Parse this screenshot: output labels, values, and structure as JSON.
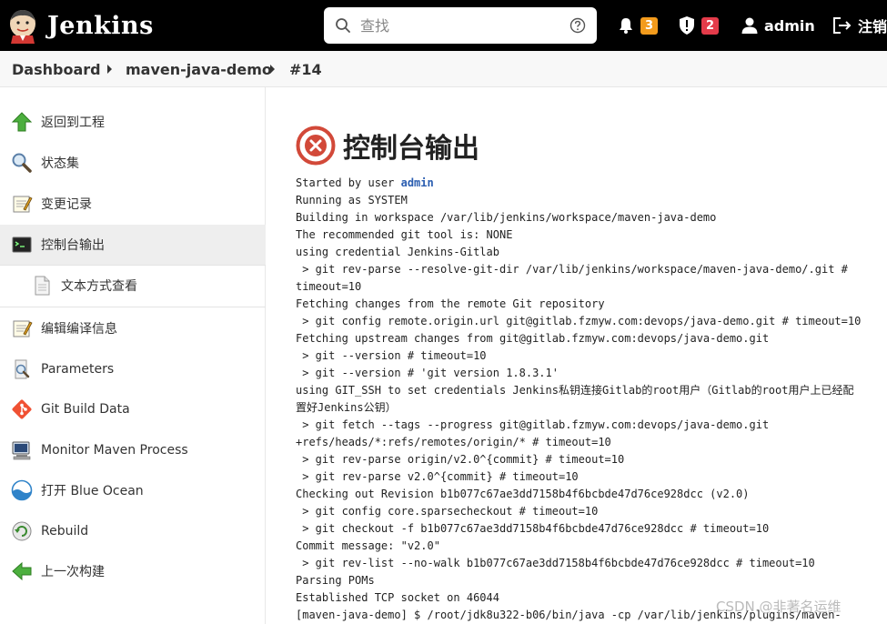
{
  "header": {
    "brand": "Jenkins",
    "search_placeholder": "查找",
    "notifications_count": "3",
    "security_count": "2",
    "user": "admin",
    "logout": "注销"
  },
  "breadcrumb": [
    "Dashboard",
    "maven-java-demo",
    "#14"
  ],
  "sidebar": {
    "items": [
      {
        "label": "返回到工程",
        "icon": "up-arrow-icon"
      },
      {
        "label": "状态集",
        "icon": "magnifier-icon"
      },
      {
        "label": "变更记录",
        "icon": "notepad-icon"
      },
      {
        "label": "控制台输出",
        "icon": "terminal-icon"
      },
      {
        "label": "文本方式查看",
        "icon": "document-icon"
      },
      {
        "label": "编辑编译信息",
        "icon": "notepad-icon"
      },
      {
        "label": "Parameters",
        "icon": "magnifier-doc-icon"
      },
      {
        "label": "Git Build Data",
        "icon": "git-icon"
      },
      {
        "label": "Monitor Maven Process",
        "icon": "computer-icon"
      },
      {
        "label": "打开 Blue Ocean",
        "icon": "blue-ocean-icon"
      },
      {
        "label": "Rebuild",
        "icon": "rebuild-icon"
      },
      {
        "label": "上一次构建",
        "icon": "back-arrow-icon"
      }
    ]
  },
  "main": {
    "title": "控制台输出",
    "status_color": "#d24939",
    "console_prefix": "Started by user ",
    "console_user": "admin",
    "console_lines": [
      "Running as SYSTEM",
      "Building in workspace /var/lib/jenkins/workspace/maven-java-demo",
      "The recommended git tool is: NONE",
      "using credential Jenkins-Gitlab",
      " > git rev-parse --resolve-git-dir /var/lib/jenkins/workspace/maven-java-demo/.git #",
      "timeout=10",
      "Fetching changes from the remote Git repository",
      " > git config remote.origin.url git@gitlab.fzmyw.com:devops/java-demo.git # timeout=10",
      "Fetching upstream changes from git@gitlab.fzmyw.com:devops/java-demo.git",
      " > git --version # timeout=10",
      " > git --version # 'git version 1.8.3.1'",
      "using GIT_SSH to set credentials Jenkins私钥连接Gitlab的root用户（Gitlab的root用户上已经配",
      "置好Jenkins公钥）",
      " > git fetch --tags --progress git@gitlab.fzmyw.com:devops/java-demo.git",
      "+refs/heads/*:refs/remotes/origin/* # timeout=10",
      " > git rev-parse origin/v2.0^{commit} # timeout=10",
      " > git rev-parse v2.0^{commit} # timeout=10",
      "Checking out Revision b1b077c67ae3dd7158b4f6bcbde47d76ce928dcc (v2.0)",
      " > git config core.sparsecheckout # timeout=10",
      " > git checkout -f b1b077c67ae3dd7158b4f6bcbde47d76ce928dcc # timeout=10",
      "Commit message: \"v2.0\"",
      " > git rev-list --no-walk b1b077c67ae3dd7158b4f6bcbde47d76ce928dcc # timeout=10",
      "Parsing POMs",
      "Established TCP socket on 46044",
      "[maven-java-demo] $ /root/jdk8u322-b06/bin/java -cp /var/lib/jenkins/plugins/maven-"
    ]
  },
  "watermark": "CSDN @非著名运维"
}
